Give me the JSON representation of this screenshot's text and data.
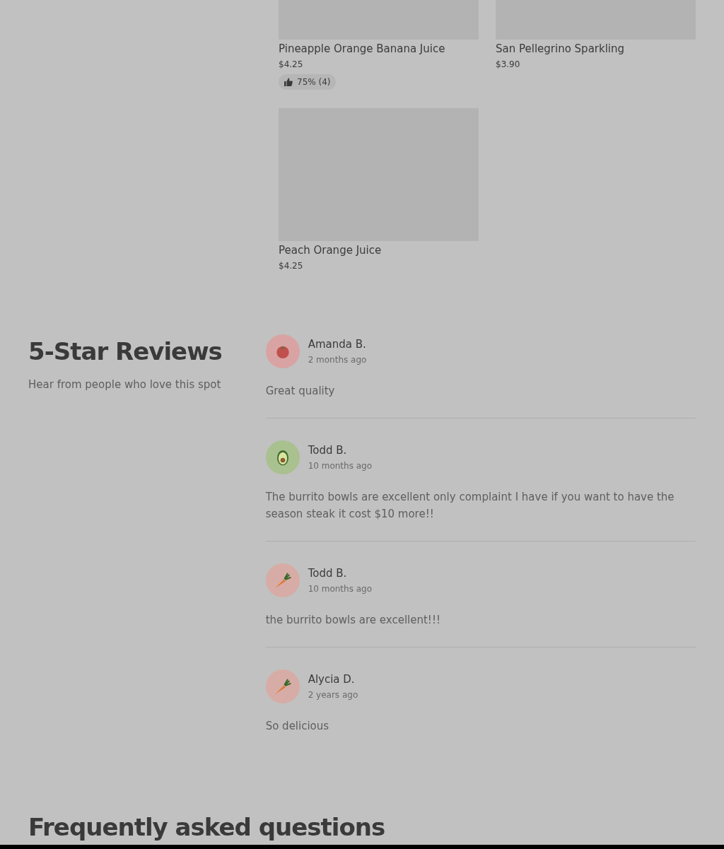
{
  "products": [
    {
      "name": "Pineapple Orange Banana Juice",
      "price": "$4.25",
      "rating": "75% (4)",
      "image_cut": true
    },
    {
      "name": "San Pellegrino Sparkling",
      "price": "$3.90",
      "image_cut": true
    },
    {
      "name": "Peach Orange Juice",
      "price": "$4.25",
      "image_cut": false
    }
  ],
  "reviews_section": {
    "title": "5-Star Reviews",
    "subtitle": "Hear from people who love this spot"
  },
  "reviews": [
    {
      "avatar": {
        "kind": "tomato"
      },
      "author": "Amanda B.",
      "time": "2 months ago",
      "text": "Great quality"
    },
    {
      "avatar": {
        "kind": "avocado"
      },
      "author": "Todd B.",
      "time": "10 months ago",
      "text": "The burrito bowls are excellent only complaint I have if you want to have the season steak it cost $10 more!!"
    },
    {
      "avatar": {
        "kind": "carrot"
      },
      "author": "Todd B.",
      "time": "10 months ago",
      "text": "the burrito bowls are excellent!!!"
    },
    {
      "avatar": {
        "kind": "carrot"
      },
      "author": "Alycia D.",
      "time": "2 years ago",
      "text": "So delicious"
    }
  ],
  "faq": {
    "title": "Frequently asked questions"
  }
}
